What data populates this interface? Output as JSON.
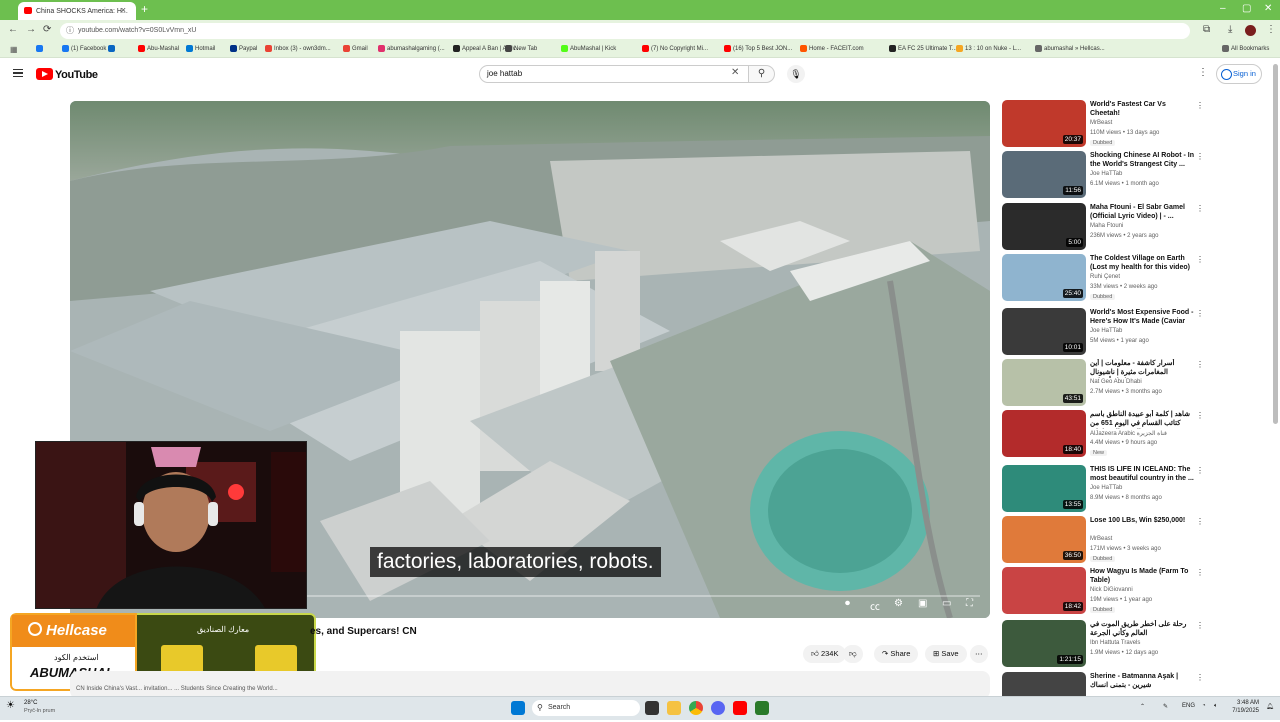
{
  "browser": {
    "tab_title": "China SHOCKS America: H...",
    "new_tab": "+",
    "url": "youtube.com/watch?v=0S0LvVmn_xU",
    "bookmarks": [
      {
        "label": "",
        "color": "#1877f2"
      },
      {
        "label": "(1) Facebook",
        "color": "#1877f2"
      },
      {
        "label": "",
        "color": "#0a66c2"
      },
      {
        "label": "Abu-Mashal",
        "color": "#ff0000"
      },
      {
        "label": "Hotmail",
        "color": "#0078d4"
      },
      {
        "label": "Paypal",
        "color": "#003087"
      },
      {
        "label": "Inbox (3) - own3dm...",
        "color": "#ea4335"
      },
      {
        "label": "Gmail",
        "color": "#ea4335"
      },
      {
        "label": "abumashalgaming (...",
        "color": "#e1306c"
      },
      {
        "label": "Appeal A Ban | Activ...",
        "color": "#222222"
      },
      {
        "label": "New Tab",
        "color": "#444444"
      },
      {
        "label": "AbuMashal | Kick",
        "color": "#53fc18"
      },
      {
        "label": "(7) No Copyright Mi...",
        "color": "#ff0000"
      },
      {
        "label": "(16) Top 5 Best JON...",
        "color": "#ff0000"
      },
      {
        "label": "Home - FACEIT.com",
        "color": "#ff5500"
      },
      {
        "label": "EA FC 25 Ultimate T...",
        "color": "#222222"
      },
      {
        "label": "13 : 10 on Nuke - L...",
        "color": "#f5a623"
      },
      {
        "label": "abumashal » Hellcas...",
        "color": "#666666"
      },
      {
        "label": "All Bookmarks",
        "color": "#666666"
      }
    ]
  },
  "youtube": {
    "logo_text": "YouTube",
    "search_value": "joe hattab",
    "sign_in": "Sign in"
  },
  "video": {
    "caption": "factories, laboratories, robots.",
    "title_visible": "es, and Supercars! CN",
    "likes": "234K",
    "share": "Share",
    "save": "Save",
    "description_snippet": "CN Inside China's Vast... invitation... ... Students Since Creating the World..."
  },
  "overlay": {
    "brand": "Hellcase",
    "code_label": "استخدم الكود",
    "code": "ABUMASHAL",
    "promo_title": "معارك الصناديق"
  },
  "recommendations": [
    {
      "title": "World's Fastest Car Vs Cheetah!",
      "channel": "MrBeast",
      "meta": "110M views • 13 days ago",
      "badge": "Dubbed",
      "duration": "20:37",
      "thumb": "#c0392b"
    },
    {
      "title": "Shocking Chinese AI Robot - In the World's Strangest City ...",
      "channel": "Joe HaTTab",
      "meta": "6.1M views • 1 month ago",
      "badge": "",
      "duration": "11:56",
      "thumb": "#5a6b78"
    },
    {
      "title": "Maha Ftouni - El Sabr Gamel (Official Lyric Video) | - ...",
      "channel": "Maha Ftouni",
      "meta": "236M views • 2 years ago",
      "badge": "",
      "duration": "5:00",
      "thumb": "#2b2b2b"
    },
    {
      "title": "The Coldest Village on Earth (Lost my health for this video) ...",
      "channel": "Ruhi Çenet",
      "meta": "33M views • 2 weeks ago",
      "badge": "Dubbed",
      "duration": "25:40",
      "thumb": "#8fb4cf"
    },
    {
      "title": "World's Most Expensive Food - Here's How It's Made (Caviar I...",
      "channel": "Joe HaTTab",
      "meta": "5M views • 1 year ago",
      "badge": "",
      "duration": "10:01",
      "thumb": "#3a3a3a"
    },
    {
      "title": "أسرار كاشفة - معلومات | أين المغامرات مثيرة | ناشيونال جيوغرافيك أبوظبي",
      "channel": "Nat Geo Abu Dhabi",
      "meta": "2.7M views • 3 months ago",
      "badge": "",
      "duration": "43:51",
      "thumb": "#b7c1a8"
    },
    {
      "title": "شاهد | كلمة أبو عبيدة الناطق باسم كتائب القسام في اليوم 651 من الحرب الإسرائيلية",
      "channel": "AlJazeera Arabic قناة الجزيرة",
      "meta": "4.4M views • 9 hours ago",
      "badge": "New",
      "duration": "18:40",
      "thumb": "#b32b2b"
    },
    {
      "title": "THIS IS LIFE IN ICELAND: The most beautiful country in the ...",
      "channel": "Joe HaTTab",
      "meta": "8.9M views • 8 months ago",
      "badge": "",
      "duration": "13:55",
      "thumb": "#2e8b7a"
    },
    {
      "title": "Lose 100 LBs, Win $250,000!",
      "channel": "MrBeast",
      "meta": "171M views • 3 weeks ago",
      "badge": "Dubbed",
      "duration": "36:50",
      "thumb": "#e07a3a"
    },
    {
      "title": "How Wagyu Is Made (Farm To Table)",
      "channel": "Nick DiGiovanni",
      "meta": "19M views • 1 year ago",
      "badge": "Dubbed",
      "duration": "18:42",
      "thumb": "#c94444"
    },
    {
      "title": "رحلة على أخطر طريق الموت في العالم وكأني الجرعة",
      "channel": "Ibn Hattuta Travels",
      "meta": "1.9M views • 12 days ago",
      "badge": "",
      "duration": "1:21:15",
      "thumb": "#3d5a3d"
    },
    {
      "title": "Sherine - Batmanna Aşak | شيرين - بتمنى انساك",
      "channel": "",
      "meta": "",
      "badge": "",
      "duration": "",
      "thumb": "#444444"
    }
  ],
  "taskbar": {
    "weather_temp": "28°C",
    "weather_desc": "Pryč-ln prum",
    "search": "Search",
    "lang": "ENG",
    "time": "3:48 AM",
    "date": "7/19/2025"
  }
}
